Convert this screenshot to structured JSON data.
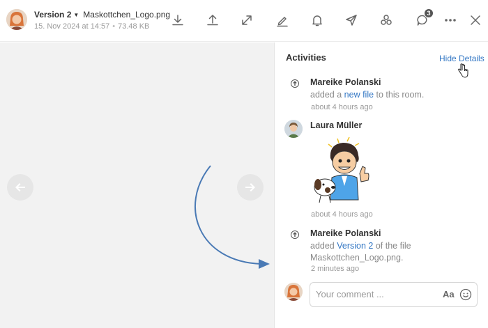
{
  "header": {
    "version_label": "Version 2",
    "filename": "Maskottchen_Logo.png",
    "date": "15. Nov 2024 at 14:57",
    "size": "73.48 KB",
    "comments_badge": "3"
  },
  "toolbar": {
    "icons": [
      "download-icon",
      "upload-icon",
      "expand-icon",
      "edit-icon",
      "bell-icon",
      "send-icon",
      "share-icon",
      "comments-icon",
      "more-icon",
      "close-icon"
    ]
  },
  "sidebar": {
    "title": "Activities",
    "hide_details": "Hide Details",
    "entries": [
      {
        "author": "Mareike Polanski",
        "text_before": "added a ",
        "link": "new file",
        "text_after": " to this room.",
        "time": "about 4 hours ago"
      },
      {
        "author": "Laura Müller",
        "time": "about 4 hours ago"
      },
      {
        "author": "Mareike Polanski",
        "text_before": "added ",
        "link": "Version 2",
        "text_after": " of the file",
        "text_line2": "Maskottchen_Logo.png.",
        "time": "2 minutes ago"
      }
    ]
  },
  "comment": {
    "placeholder": "Your comment ...",
    "format_label": "Aa"
  },
  "colors": {
    "accent": "#3377c4",
    "arrow": "#4a7ab5"
  }
}
